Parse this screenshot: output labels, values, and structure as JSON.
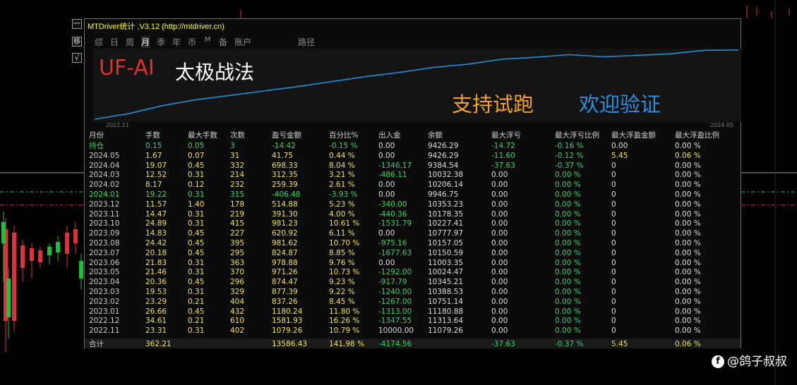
{
  "side_buttons": [
    "一",
    "移",
    "√"
  ],
  "panel": {
    "title": "MTDriver统计 ,V3.12 (http://mtdriver.cn)",
    "tabs": [
      {
        "label": "综",
        "active": false
      },
      {
        "label": "日",
        "active": false
      },
      {
        "label": "周",
        "active": false
      },
      {
        "label": "月",
        "active": true
      },
      {
        "label": "季",
        "active": false
      },
      {
        "label": "年",
        "active": false
      },
      {
        "label": "币",
        "active": false
      },
      {
        "label": "M",
        "active": false
      },
      {
        "label": "备",
        "active": false
      },
      {
        "label": "账户",
        "active": false
      },
      {
        "label": "路径",
        "active": false
      }
    ]
  },
  "overlay": {
    "brand": "UF-AI",
    "strategy": "太极战法",
    "trial": "支持试跑",
    "verify": "欢迎验证",
    "brand_color": "#e0302a",
    "trial_color": "#f2a124",
    "verify_color": "#2a8fe0"
  },
  "equity_chart": {
    "x_start": "2022.11",
    "x_end": "2024.05",
    "line_color": "#1e90d8"
  },
  "table": {
    "headers": [
      "月份",
      "手数",
      "最大手数",
      "次数",
      "盈亏金额",
      "百分比%",
      "出入金",
      "余额",
      "最大浮亏",
      "最大浮亏比例",
      "最大浮盈金额",
      "最大浮盈比例"
    ],
    "rows": [
      [
        "持仓",
        "0.15",
        "0.05",
        "3",
        "-14.42",
        "-0.15 %",
        "0.00",
        "9426.29",
        "-14.72",
        "-0.16 %",
        "0.00",
        "0.00 %"
      ],
      [
        "2024.05",
        "1.67",
        "0.07",
        "31",
        "41.75",
        "0.44 %",
        "0.00",
        "9426.29",
        "-11.60",
        "-0.12 %",
        "5.45",
        "0.06 %"
      ],
      [
        "2024.04",
        "19.07",
        "0.45",
        "332",
        "698.33",
        "8.04 %",
        "-1346.17",
        "9384.54",
        "-37.63",
        "-0.37 %",
        "0",
        "0.00 %"
      ],
      [
        "2024.03",
        "12.52",
        "0.31",
        "214",
        "312.35",
        "3.21 %",
        "-486.11",
        "10032.38",
        "0.00",
        "0.00 %",
        "0",
        "0.00 %"
      ],
      [
        "2024.02",
        "8.17",
        "0.12",
        "232",
        "259.39",
        "2.61 %",
        "0.00",
        "10206.14",
        "0.00",
        "0.00 %",
        "0",
        "0.00 %"
      ],
      [
        "2024.01",
        "19.22",
        "0.31",
        "315",
        "-406.48",
        "-3.93 %",
        "0.00",
        "9946.75",
        "0.00",
        "0.00 %",
        "0",
        "0.00 %"
      ],
      [
        "2023.12",
        "11.57",
        "1.40",
        "178",
        "514.88",
        "5.23 %",
        "-340.00",
        "10353.23",
        "0.00",
        "0.00 %",
        "0",
        "0.00 %"
      ],
      [
        "2023.11",
        "14.47",
        "0.31",
        "219",
        "391.30",
        "4.00 %",
        "-440.36",
        "10178.35",
        "0.00",
        "0.00 %",
        "0",
        "0.00 %"
      ],
      [
        "2023.10",
        "24.89",
        "0.31",
        "415",
        "981.23",
        "10.61 %",
        "-1531.79",
        "10227.41",
        "0.00",
        "0.00 %",
        "0",
        "0.00 %"
      ],
      [
        "2023.09",
        "14.83",
        "0.45",
        "227",
        "620.92",
        "6.11 %",
        "0.00",
        "10777.97",
        "0.00",
        "0.00 %",
        "0",
        "0.00 %"
      ],
      [
        "2023.08",
        "24.42",
        "0.45",
        "395",
        "981.62",
        "10.70 %",
        "-975.16",
        "10157.05",
        "0.00",
        "0.00 %",
        "0",
        "0.00 %"
      ],
      [
        "2023.07",
        "20.18",
        "0.45",
        "295",
        "824.87",
        "8.85 %",
        "-1677.63",
        "10150.59",
        "0.00",
        "0.00 %",
        "0",
        "0.00 %"
      ],
      [
        "2023.06",
        "21.83",
        "0.31",
        "363",
        "978.88",
        "9.76 %",
        "0.00",
        "11003.35",
        "0.00",
        "0.00 %",
        "0",
        "0.00 %"
      ],
      [
        "2023.05",
        "21.46",
        "0.31",
        "370",
        "971.26",
        "10.73 %",
        "-1292.00",
        "10024.47",
        "0.00",
        "0.00 %",
        "0",
        "0.00 %"
      ],
      [
        "2023.04",
        "20.36",
        "0.45",
        "296",
        "874.47",
        "9.23 %",
        "-917.79",
        "10345.21",
        "0.00",
        "0.00 %",
        "0",
        "0.00 %"
      ],
      [
        "2023.03",
        "19.53",
        "0.31",
        "329",
        "877.39",
        "9.22 %",
        "-1240.00",
        "10388.53",
        "0.00",
        "0.00 %",
        "0",
        "0.00 %"
      ],
      [
        "2023.02",
        "23.29",
        "0.21",
        "404",
        "837.26",
        "8.45 %",
        "-1267.00",
        "10751.14",
        "0.00",
        "0.00 %",
        "0",
        "0.00 %"
      ],
      [
        "2023.01",
        "26.66",
        "0.45",
        "432",
        "1180.24",
        "11.80 %",
        "-1313.00",
        "11180.88",
        "0.00",
        "0.00 %",
        "0",
        "0.00 %"
      ],
      [
        "2022.12",
        "34.61",
        "0.21",
        "610",
        "1581.93",
        "16.26 %",
        "-1347.55",
        "11313.64",
        "0.00",
        "0.00 %",
        "0",
        "0.00 %"
      ],
      [
        "2022.11",
        "23.31",
        "0.31",
        "402",
        "1079.26",
        "10.79 %",
        "10000.00",
        "11079.26",
        "0.00",
        "0.00 %",
        "0",
        "0.00 %"
      ]
    ],
    "total": [
      "合计",
      "362.21",
      "",
      "",
      "13586.43",
      "141.98 %",
      "-4174.56",
      "",
      "-37.63",
      "-0.37 %",
      "5.45",
      "0.06 %"
    ]
  },
  "watermark": {
    "icon": "f",
    "text": "@鸽子叔叔"
  }
}
